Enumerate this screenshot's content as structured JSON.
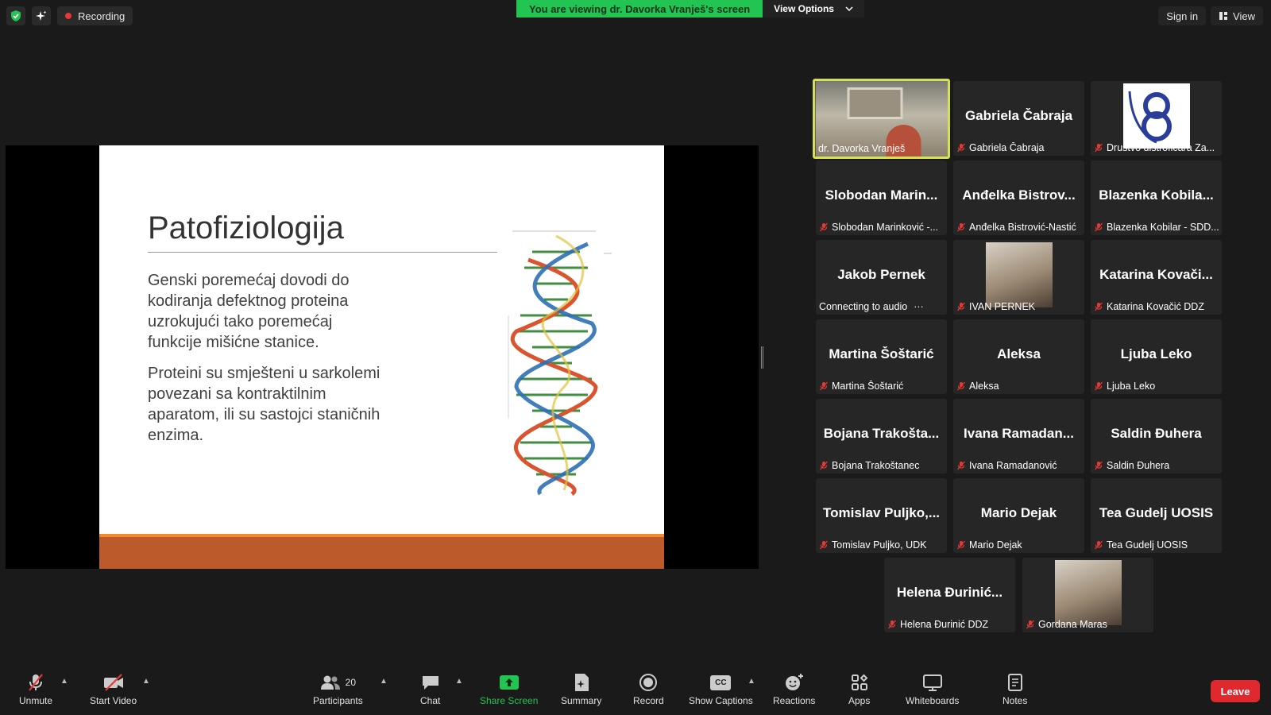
{
  "top_bar": {
    "recording_label": "Recording",
    "banner_text": "You are viewing dr. Davorka Vranješ's screen",
    "view_options_label": "View Options",
    "sign_in_label": "Sign in",
    "view_label": "View"
  },
  "slide": {
    "title": "Patofiziologija",
    "paragraph1": "Genski poremećaj dovodi do kodiranja defektnog proteina uzrokujući tako poremećaj funkcije mišićne stanice.",
    "paragraph2": "Proteini su smješteni u sarkolemi povezani sa kontraktilnim aparatom, ili su sastojci staničnih enzima."
  },
  "participants": [
    {
      "big": "",
      "label": "dr. Davorka Vranješ",
      "active": true,
      "photo": true
    },
    {
      "big": "Gabriela Čabraja",
      "label": "Gabriela Čabraja"
    },
    {
      "big": "",
      "label": "Drustvo distroficara Za...",
      "logo": true
    },
    {
      "big": "Slobodan Marin...",
      "label": "Slobodan Marinković -..."
    },
    {
      "big": "Anđelka Bistrov...",
      "label": "Anđelka Bistrović-Nastić"
    },
    {
      "big": "Blazenka Kobila...",
      "label": "Blazenka Kobilar - SDD..."
    },
    {
      "big": "Jakob Pernek",
      "label": "Connecting to audio",
      "connecting": true
    },
    {
      "big": "",
      "label": "IVAN PERNEK",
      "photo": true
    },
    {
      "big": "Katarina Kovači...",
      "label": "Katarina Kovačić DDZ"
    },
    {
      "big": "Martina Šoštarić",
      "label": "Martina Šoštarić"
    },
    {
      "big": "Aleksa",
      "label": "Aleksa"
    },
    {
      "big": "Ljuba Leko",
      "label": "Ljuba Leko"
    },
    {
      "big": "Bojana Trakošta...",
      "label": "Bojana Trakoštanec"
    },
    {
      "big": "Ivana Ramadan...",
      "label": "Ivana Ramadanović"
    },
    {
      "big": "Saldin Đuhera",
      "label": "Saldin Đuhera"
    },
    {
      "big": "Tomislav Puljko,...",
      "label": "Tomislav Puljko, UDK"
    },
    {
      "big": "Mario Dejak",
      "label": "Mario Dejak"
    },
    {
      "big": "Tea Gudelj UOSIS",
      "label": "Tea Gudelj UOSIS"
    },
    {
      "big": "Helena Đurinić...",
      "label": "Helena Đurinić DDZ"
    },
    {
      "big": "",
      "label": "Gordana Maras",
      "photo": true
    }
  ],
  "toolbar": {
    "unmute": "Unmute",
    "start_video": "Start Video",
    "participants": "Participants",
    "participants_count": "20",
    "chat": "Chat",
    "share_screen": "Share Screen",
    "summary": "Summary",
    "record": "Record",
    "show_captions": "Show Captions",
    "captions_icon_text": "CC",
    "reactions": "Reactions",
    "apps": "Apps",
    "whiteboards": "Whiteboards",
    "notes": "Notes",
    "leave": "Leave"
  },
  "colors": {
    "share_green": "#23c552",
    "active_border": "#d4e157",
    "leave_red": "#e0282f",
    "mic_muted_red": "#e53935"
  }
}
